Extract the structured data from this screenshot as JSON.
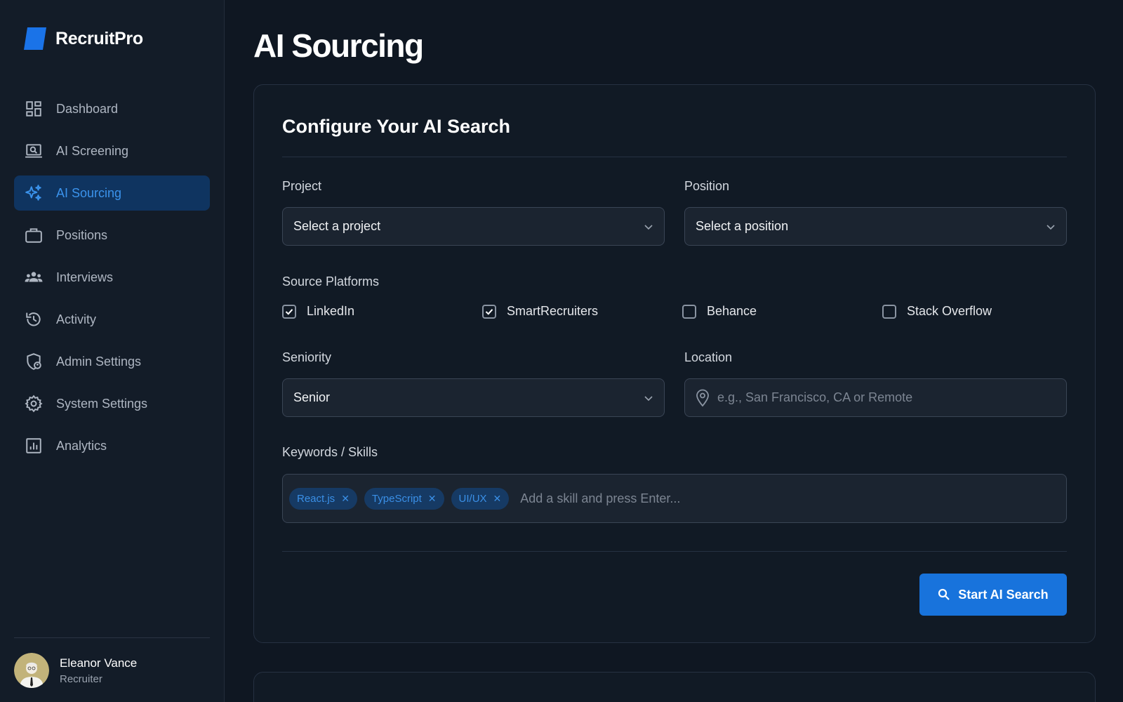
{
  "brand": {
    "name": "RecruitPro",
    "accent": "#1a73e8"
  },
  "sidebar": {
    "items": [
      {
        "label": "Dashboard",
        "icon": "dashboard-icon",
        "active": false
      },
      {
        "label": "AI Screening",
        "icon": "screening-icon",
        "active": false
      },
      {
        "label": "AI Sourcing",
        "icon": "sparkle-icon",
        "active": true
      },
      {
        "label": "Positions",
        "icon": "briefcase-icon",
        "active": false
      },
      {
        "label": "Interviews",
        "icon": "people-icon",
        "active": false
      },
      {
        "label": "Activity",
        "icon": "history-icon",
        "active": false
      },
      {
        "label": "Admin Settings",
        "icon": "admin-shield-icon",
        "active": false
      },
      {
        "label": "System Settings",
        "icon": "gear-icon",
        "active": false
      },
      {
        "label": "Analytics",
        "icon": "analytics-icon",
        "active": false
      }
    ],
    "user": {
      "name": "Eleanor Vance",
      "role": "Recruiter"
    }
  },
  "page": {
    "title": "AI Sourcing"
  },
  "form": {
    "title": "Configure Your AI Search",
    "project": {
      "label": "Project",
      "value": "Select a project"
    },
    "position": {
      "label": "Position",
      "value": "Select a position"
    },
    "platforms": {
      "label": "Source Platforms",
      "options": [
        {
          "label": "LinkedIn",
          "checked": true
        },
        {
          "label": "SmartRecruiters",
          "checked": true
        },
        {
          "label": "Behance",
          "checked": false
        },
        {
          "label": "Stack Overflow",
          "checked": false
        }
      ]
    },
    "seniority": {
      "label": "Seniority",
      "value": "Senior"
    },
    "location": {
      "label": "Location",
      "placeholder": "e.g., San Francisco, CA or Remote",
      "value": ""
    },
    "keywords": {
      "label": "Keywords / Skills",
      "tags": [
        "React.js",
        "TypeScript",
        "UI/UX"
      ],
      "placeholder": "Add a skill and press Enter..."
    },
    "submit_label": "Start AI Search"
  }
}
